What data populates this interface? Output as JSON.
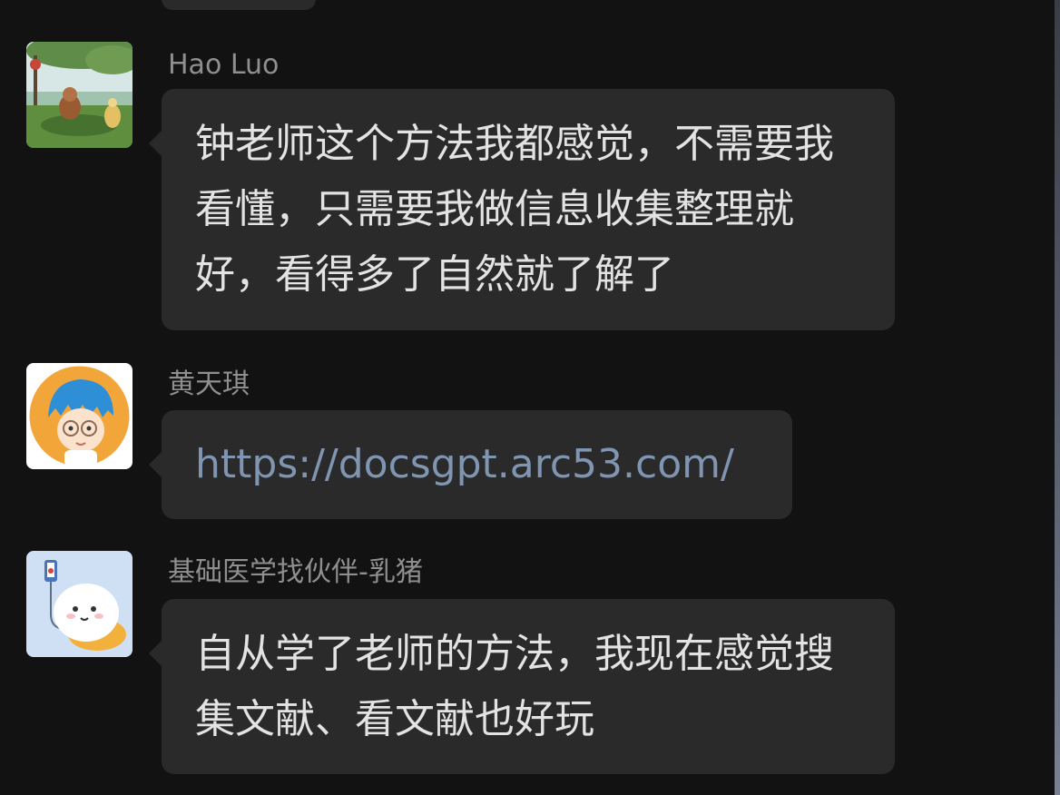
{
  "messages": [
    {
      "sender": "Hao Luo",
      "avatar_icon": "landscape-cartoon-avatar-icon",
      "text": "钟老师这个方法我都感觉，不需要我看懂，只需要我做信息收集整理就好，看得多了自然就了解了"
    },
    {
      "sender": "黄天琪",
      "avatar_icon": "cartoon-boy-glasses-avatar-icon",
      "text": "https://docsgpt.arc53.com/"
    },
    {
      "sender": "基础医学找伙伴-乳猪",
      "avatar_icon": "cute-blob-character-avatar-icon",
      "text": "自从学了老师的方法，我现在感觉搜集文献、看文献也好玩"
    }
  ],
  "colors": {
    "background": "#121212",
    "bubble": "#2a2a2a",
    "text": "#e3e3e3",
    "sender": "#8f8f8f",
    "link": "#7f95b1"
  }
}
